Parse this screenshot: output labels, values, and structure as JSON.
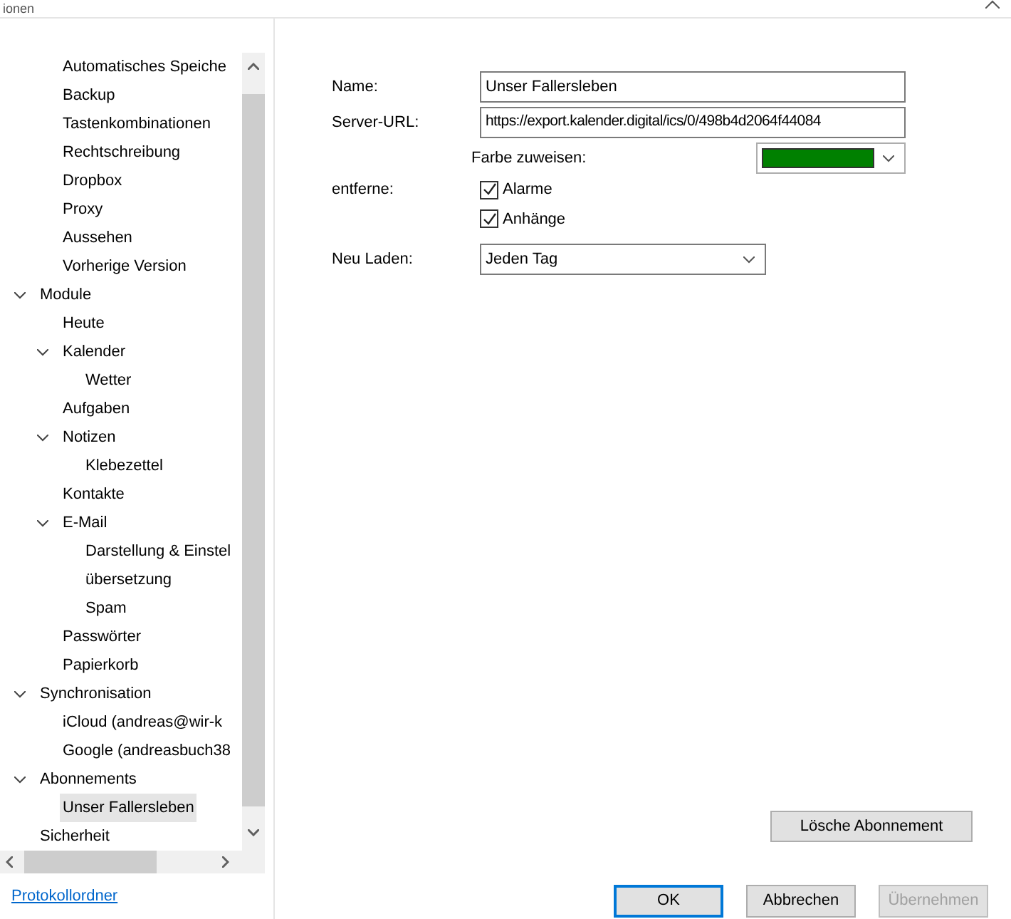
{
  "window": {
    "title": "ionen"
  },
  "tree": [
    {
      "children": [
        {
          "label": "Automatisches Speiche",
          "selected": false
        },
        {
          "label": "Backup",
          "selected": false
        },
        {
          "label": "Tastenkombinationen",
          "selected": false
        },
        {
          "label": "Rechtschreibung",
          "selected": false
        },
        {
          "label": "Dropbox",
          "selected": false
        },
        {
          "label": "Proxy",
          "selected": false
        },
        {
          "label": "Aussehen",
          "selected": false
        },
        {
          "label": "Vorherige Version",
          "selected": false
        }
      ]
    },
    {
      "label": "Module",
      "selected": false,
      "expanded": true,
      "children": [
        {
          "label": "Heute",
          "selected": false
        },
        {
          "label": "Kalender",
          "selected": false,
          "expanded": true,
          "children": [
            {
              "label": "Wetter",
              "selected": false
            }
          ]
        },
        {
          "label": "Aufgaben",
          "selected": false
        },
        {
          "label": "Notizen",
          "selected": false,
          "expanded": true,
          "children": [
            {
              "label": "Klebezettel",
              "selected": false
            }
          ]
        },
        {
          "label": "Kontakte",
          "selected": false
        },
        {
          "label": "E-Mail",
          "selected": false,
          "expanded": true,
          "children": [
            {
              "label": "Darstellung & Einstel",
              "selected": false
            },
            {
              "label": "übersetzung",
              "selected": false
            },
            {
              "label": "Spam",
              "selected": false
            }
          ]
        },
        {
          "label": "Passwörter",
          "selected": false
        },
        {
          "label": "Papierkorb",
          "selected": false
        }
      ]
    },
    {
      "label": "Synchronisation",
      "selected": false,
      "expanded": true,
      "children": [
        {
          "label": "iCloud (andreas@wir-k",
          "selected": false
        },
        {
          "label": "Google (andreasbuch38",
          "selected": false
        }
      ]
    },
    {
      "label": "Abonnements",
      "selected": false,
      "expanded": true,
      "children": [
        {
          "label": "Unser Fallersleben",
          "selected": true
        }
      ]
    },
    {
      "label": "Sicherheit",
      "selected": false
    }
  ],
  "log_link": "Protokollordner",
  "form": {
    "name_label": "Name:",
    "name_value": "Unser Fallersleben",
    "url_label": "Server-URL:",
    "url_value": "https://export.kalender.digital/ics/0/498b4d2064f44084",
    "color_label": "Farbe zuweisen:",
    "color": "#008000",
    "remove_label": "entferne:",
    "checkboxes": [
      {
        "label": "Alarme",
        "checked": true
      },
      {
        "label": "Anhänge",
        "checked": true
      }
    ],
    "reload_label": "Neu Laden:",
    "reload_value": "Jeden Tag"
  },
  "delete_button": "Lösche Abonnement",
  "buttons": [
    {
      "label": "OK",
      "kind": "default",
      "disabled": false
    },
    {
      "label": "Abbrechen",
      "kind": "normal",
      "disabled": false
    },
    {
      "label": "Übernehmen",
      "kind": "normal",
      "disabled": true
    }
  ]
}
